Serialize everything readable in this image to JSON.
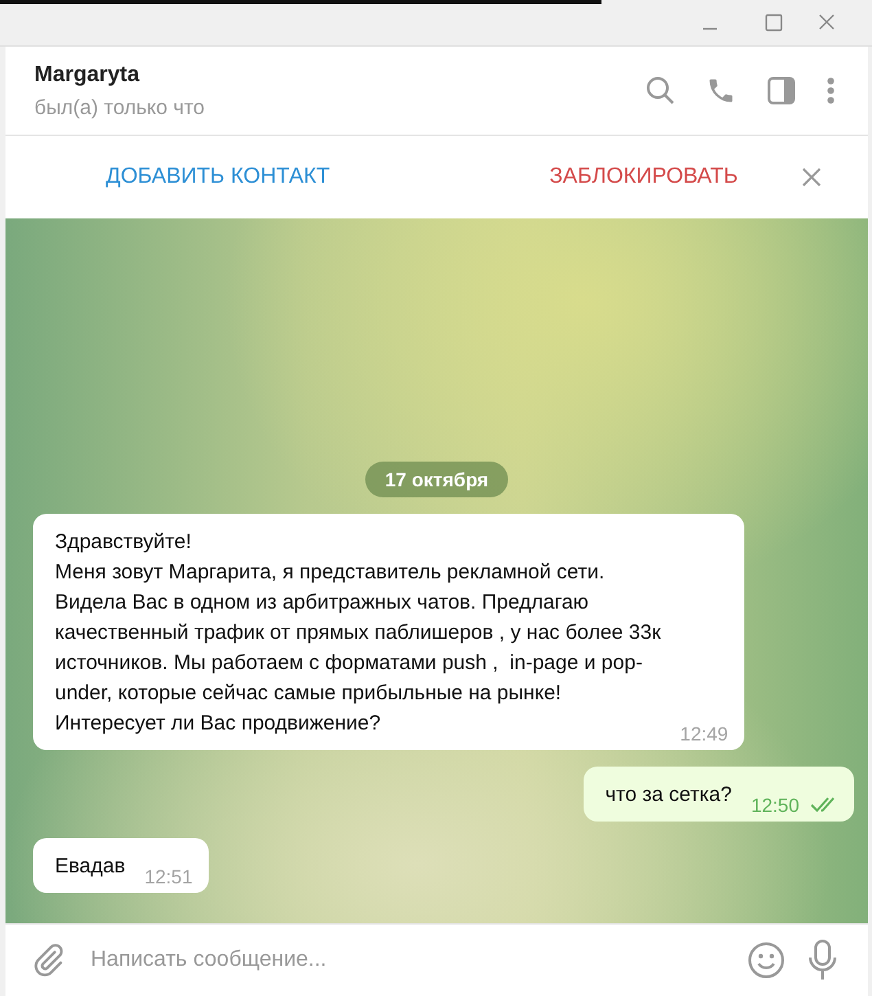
{
  "chat": {
    "name": "Margaryta",
    "status": "был(а) только что"
  },
  "action_bar": {
    "add_contact": "ДОБАВИТЬ КОНТАКТ",
    "block": "ЗАБЛОКИРОВАТЬ"
  },
  "date": "17 октября",
  "messages": [
    {
      "kind": "in",
      "text": "Здравствуйте!\nМеня зовут Маргарита, я представитель рекламной сети.\nВидела Вас в одном из арбитражных чатов. Предлагаю\nкачественный трафик от прямых паблишеров , у нас более 33к\nисточников. Мы работаем с форматами push ,  in-page и pop-\nunder, которые сейчас самые прибыльные на рынке!\nИнтересует ли Вас продвижение?",
      "time": "12:49"
    },
    {
      "kind": "out",
      "text": "что за сетка?",
      "time": "12:50",
      "read": true
    },
    {
      "kind": "in",
      "text": "Евадав",
      "time": "12:51"
    }
  ],
  "composer": {
    "placeholder": "Написать сообщение..."
  }
}
